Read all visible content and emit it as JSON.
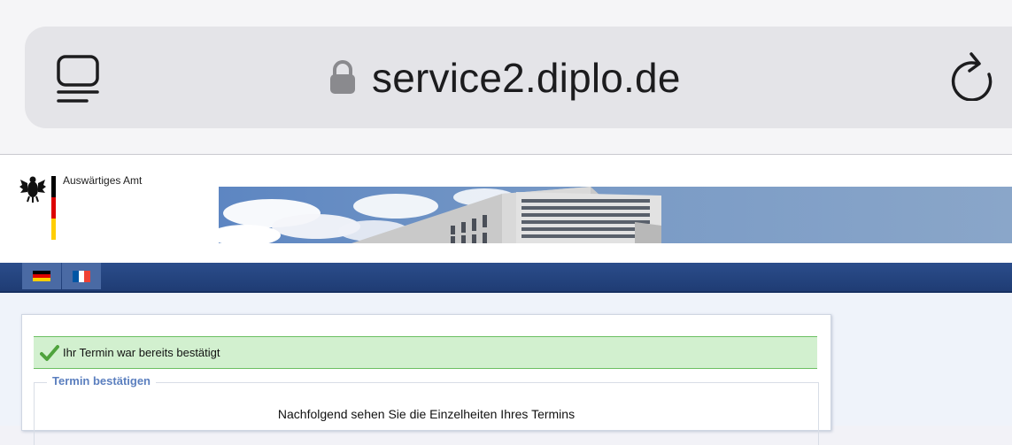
{
  "browser": {
    "url": "service2.diplo.de",
    "icons": {
      "tabs": "tabs-icon",
      "lock": "lock-icon",
      "reload": "reload-icon"
    }
  },
  "header": {
    "logo_text": "Auswärtiges Amt",
    "icons": {
      "eagle": "federal-eagle-icon"
    }
  },
  "languages": [
    {
      "code": "de",
      "icon": "flag-germany-icon"
    },
    {
      "code": "fr",
      "icon": "flag-france-icon"
    }
  ],
  "main": {
    "status_message": "Ihr Termin war bereits bestätigt",
    "section_legend": "Termin bestätigen",
    "details_intro": "Nachfolgend sehen Sie die Einzelheiten Ihres Termins"
  },
  "colors": {
    "nav_blue": "#1f3c74",
    "success_bg": "#d2f0cf",
    "success_border": "#6cc063",
    "legend_blue": "#5b7fbf"
  }
}
